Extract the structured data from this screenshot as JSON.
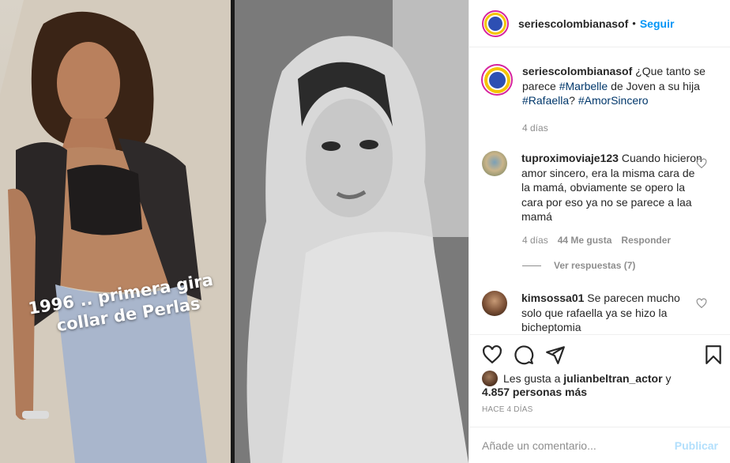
{
  "media": {
    "caption_overlay_line1": "1996 .. primera gira",
    "caption_overlay_line2": "collar de Perlas"
  },
  "header": {
    "username": "seriescolombianasof",
    "separator": "•",
    "follow_label": "Seguir"
  },
  "post_caption": {
    "username": "seriescolombianasof",
    "text_1": "¿Que tanto se parece",
    "tag_1": "#Marbelle",
    "text_2": "de Joven a su hija",
    "tag_2": "#Rafaella",
    "text_3": "?",
    "tag_3": "#AmorSincero",
    "time": "4 días"
  },
  "comments": [
    {
      "username": "tuproximoviaje123",
      "text": "Cuando hicieron amor sincero, era la misma cara de la mamá, obviamente se opero la cara por eso ya no se parece a laa mamá",
      "time": "4 días",
      "likes": "44 Me gusta",
      "reply_label": "Responder",
      "view_replies": "Ver respuestas (7)"
    },
    {
      "username": "kimsossa01",
      "text": "Se parecen mucho solo que rafaella ya se hizo la bicheptomia"
    }
  ],
  "likes": {
    "prefix": "Les gusta a",
    "user": "julianbeltran_actor",
    "suffix": "y",
    "others": "4.857 personas más"
  },
  "time_ago": "HACE 4 DÍAS",
  "composer": {
    "placeholder": "Añade un comentario...",
    "publish_label": "Publicar"
  },
  "colors": {
    "accent": "#0095f6",
    "hashtag": "#00376b",
    "muted": "#8e8e8e",
    "publish_disabled": "#b2dffc"
  }
}
